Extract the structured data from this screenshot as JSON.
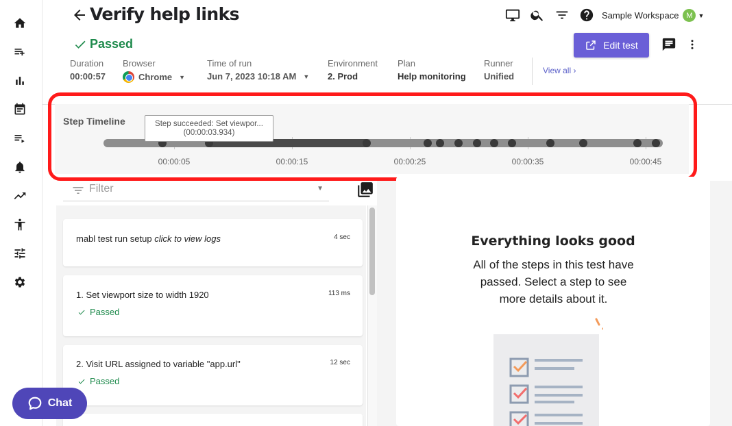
{
  "header": {
    "title": "Verify help links",
    "workspace": "Sample Workspace",
    "avatar_initial": "M",
    "status": "Passed",
    "edit_label": "Edit test",
    "view_all": "View all"
  },
  "meta": {
    "duration": {
      "label": "Duration",
      "value": "00:00:57"
    },
    "browser": {
      "label": "Browser",
      "value": "Chrome"
    },
    "time_of_run": {
      "label": "Time of run",
      "value": "Jun 7, 2023 10:18 AM"
    },
    "environment": {
      "label": "Environment",
      "value": "2. Prod"
    },
    "plan": {
      "label": "Plan",
      "value": "Help monitoring"
    },
    "runner": {
      "label": "Runner",
      "value": "Unified"
    }
  },
  "timeline": {
    "title": "Step Timeline",
    "tooltip_line1": "Step succeeded: Set viewpor...",
    "tooltip_line2": "(00:00:03.934)",
    "ticks": [
      "00:00:05",
      "00:00:15",
      "00:00:25",
      "00:00:35",
      "00:00:45"
    ]
  },
  "filter": {
    "placeholder": "Filter"
  },
  "steps": [
    {
      "title": "mabl test run setup",
      "title_em": "click to view logs",
      "duration": "4 sec",
      "status": ""
    },
    {
      "title": "1. Set viewport size to width 1920",
      "title_em": "",
      "duration": "113 ms",
      "status": "Passed"
    },
    {
      "title": "2. Visit URL assigned to variable \"app.url\"",
      "title_em": "",
      "duration": "12 sec",
      "status": "Passed"
    }
  ],
  "empty_state": {
    "title": "Everything looks good",
    "text": "All of the steps in this test have passed. Select a step to see more details about it."
  },
  "chat": {
    "label": "Chat"
  },
  "colors": {
    "accent": "#6a5fd7",
    "success": "#1e8a4c",
    "highlight": "#ff1a1a",
    "chat": "#4f46b8"
  }
}
